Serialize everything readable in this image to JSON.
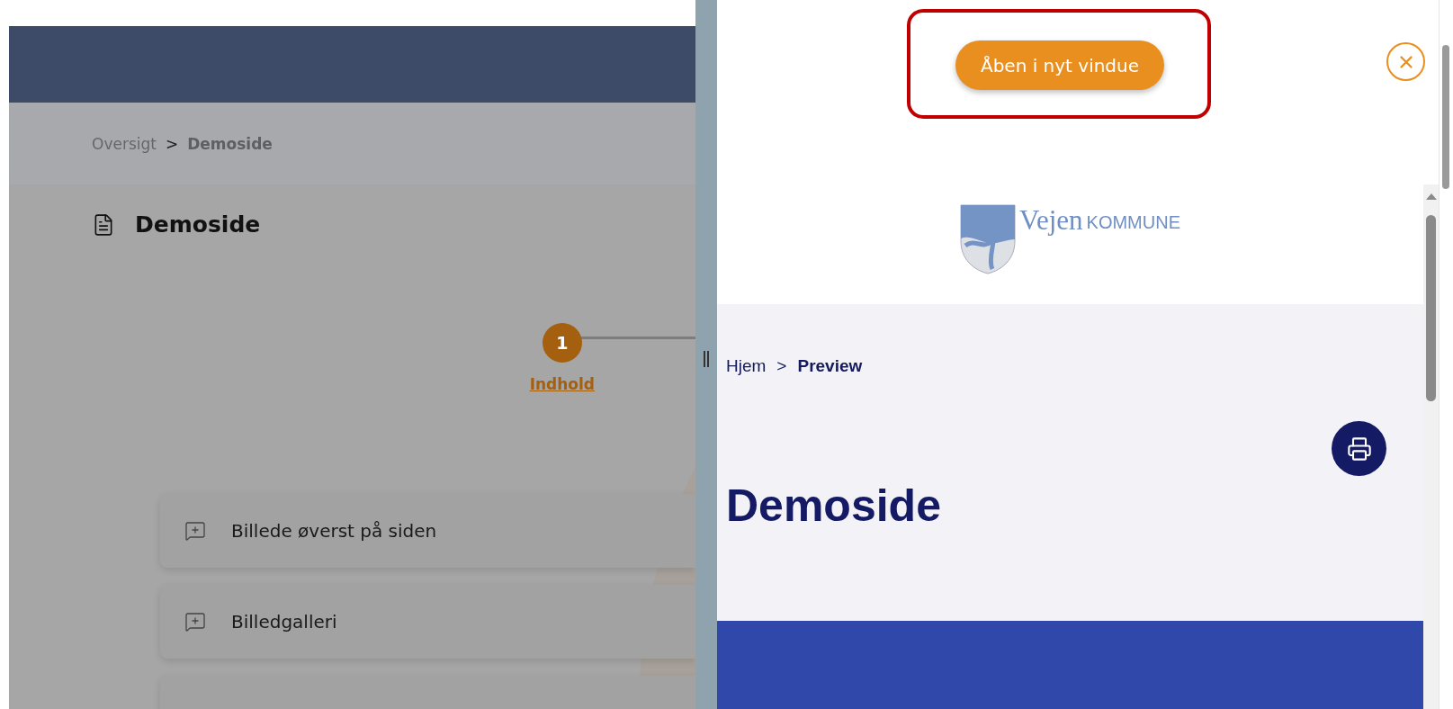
{
  "editor": {
    "breadcrumb": [
      {
        "label": "Oversigt",
        "current": false
      },
      {
        "label": "Demoside",
        "current": true,
        "separator_before": ">"
      }
    ],
    "title": "Demoside",
    "steps": [
      {
        "number": "1",
        "label": "Indhold",
        "selected": true
      }
    ],
    "blocks": [
      {
        "label": "Billede øverst på siden"
      },
      {
        "label": "Billedgalleri"
      }
    ]
  },
  "preview_panel": {
    "open_button": "Åben i nyt vindue"
  },
  "preview": {
    "logo": {
      "name": "Vejen",
      "suffix": "KOMMUNE"
    },
    "breadcrumb": [
      {
        "label": "Hjem",
        "current": false
      },
      {
        "label": "Preview",
        "current": true,
        "separator_before": ">"
      }
    ],
    "title": "Demoside"
  }
}
